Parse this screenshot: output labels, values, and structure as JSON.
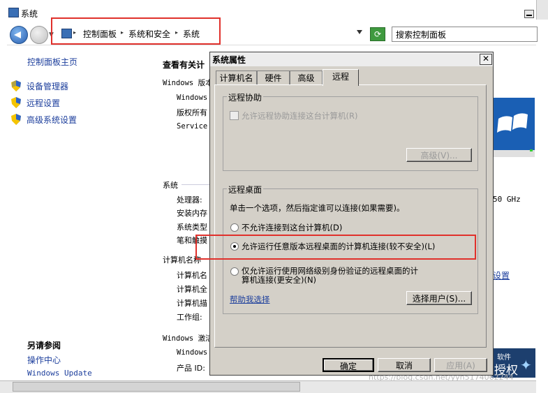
{
  "window": {
    "title": "系统"
  },
  "address_bar": {
    "crumbs": [
      "控制面板",
      "系统和安全",
      "系统"
    ],
    "search_placeholder": "搜索控制面板"
  },
  "left_pane": {
    "home": "控制面板主页",
    "items": [
      "设备管理器",
      "远程设置",
      "高级系统设置"
    ],
    "see_also_title": "另请参阅",
    "see_also": [
      "操作中心",
      "Windows Update"
    ]
  },
  "main_bg": {
    "view_title": "查看有关计",
    "edition_label": "Windows 版本",
    "edition_lines": [
      "Windows",
      "版权所有",
      "Service"
    ],
    "system_label": "系统",
    "system_rows": [
      "处理器:",
      "安装内存",
      "系统类型",
      "笔和触摸"
    ],
    "cpu_speed": "50 GHz",
    "computer_name_label": "计算机名称",
    "computer_rows": [
      "计算机名",
      "计算机全",
      "计算机描",
      "工作组:"
    ],
    "change_settings": "设置",
    "activation_label": "Windows 激活",
    "activation_rows": [
      "Windows",
      "产品 ID:"
    ],
    "genuine_badge": {
      "text": "授权",
      "small": "软件"
    }
  },
  "dialog": {
    "title": "系统属性",
    "close": "✕",
    "tabs": [
      "计算机名",
      "硬件",
      "高级",
      "远程"
    ],
    "active_tab": "远程",
    "assistance": {
      "legend": "远程协助",
      "checkbox_label": "允许远程协助连接这台计算机(R)",
      "advanced_button": "高级(V)..."
    },
    "remote_desktop": {
      "legend": "远程桌面",
      "instruction": "单击一个选项，然后指定谁可以连接(如果需要)。",
      "options": [
        "不允许连接到这台计算机(D)",
        "允许运行任意版本远程桌面的计算机连接(较不安全)(L)",
        "仅允许运行使用网络级别身份验证的远程桌面的计",
        "算机连接(更安全)(N)"
      ],
      "selected_index": 1,
      "help_link": "帮助我选择",
      "select_users_button": "选择用户(S)..."
    },
    "buttons": {
      "ok": "确定",
      "cancel": "取消",
      "apply": "应用(A)"
    }
  },
  "watermark": "https://blog.csdn.net/yyh5174062244"
}
